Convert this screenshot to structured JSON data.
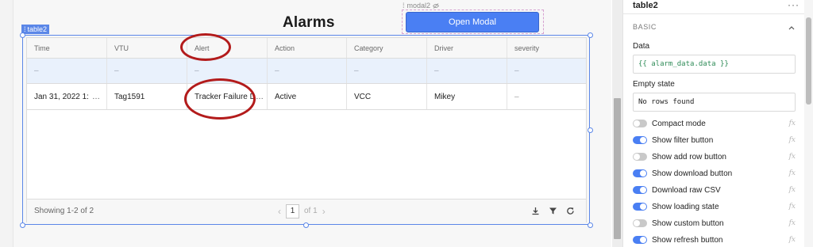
{
  "canvas": {
    "title": "Alarms",
    "modal_widget": {
      "tag_label": "modal2",
      "button_label": "Open Modal"
    },
    "table_widget": {
      "tag_label": "table2",
      "columns": [
        "Time",
        "VTU",
        "Alert",
        "Action",
        "Category",
        "Driver",
        "severity"
      ],
      "empty_row": [
        "–",
        "–",
        "–",
        "–",
        "–",
        "–",
        "–"
      ],
      "rows": [
        [
          "Jan 31, 2022 1:",
          "Tag1591",
          "Tracker Failure D",
          "Active",
          "VCC",
          "Mikey",
          "–"
        ]
      ],
      "time_overflow_icon": "…",
      "alert_overflow_icon": "…",
      "footer": {
        "showing_text": "Showing 1-2 of 2",
        "prev_icon": "‹",
        "page": "1",
        "of_text": "of 1",
        "next_icon": "›",
        "icons": [
          "download-icon",
          "filter-icon",
          "refresh-icon"
        ]
      }
    }
  },
  "panel": {
    "title": "table2",
    "menu_icon": "···",
    "section_label": "BASIC",
    "data_label": "Data",
    "data_value": "{{ alarm_data.data }}",
    "empty_state_label": "Empty state",
    "empty_state_value": "No rows found",
    "fx_label": "fx",
    "toggles": [
      {
        "label": "Compact mode",
        "on": false
      },
      {
        "label": "Show filter button",
        "on": true
      },
      {
        "label": "Show add row button",
        "on": false
      },
      {
        "label": "Show download button",
        "on": true
      },
      {
        "label": "Download raw CSV",
        "on": true
      },
      {
        "label": "Show loading state",
        "on": true
      },
      {
        "label": "Show custom button",
        "on": false
      },
      {
        "label": "Show refresh button",
        "on": true
      }
    ]
  },
  "colors": {
    "accent": "#4a7ff3",
    "annotation": "#b31b1b",
    "selection": "#5b87e8"
  }
}
